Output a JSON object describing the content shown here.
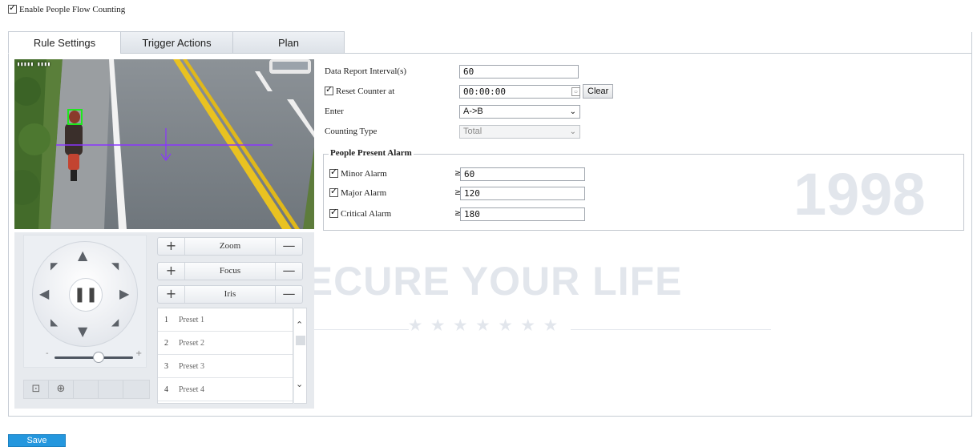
{
  "enable_people_flow": {
    "label": "Enable People Flow Counting",
    "checked": true
  },
  "tabs": [
    {
      "label": "Rule Settings",
      "active": true
    },
    {
      "label": "Trigger Actions",
      "active": false
    },
    {
      "label": "Plan",
      "active": false
    }
  ],
  "video": {
    "icons": {
      "detection_box": "green-detection-box",
      "line": "counting-line",
      "direction": "direction-arrow-down"
    },
    "colors": {
      "line": "#8a35ff",
      "detection_box": "#1ee81e"
    }
  },
  "ptz": {
    "icons": {
      "up": "▲",
      "down": "▼",
      "left": "◀",
      "right": "▶",
      "up_left": "◤",
      "up_right": "◥",
      "down_left": "◣",
      "down_right": "◢",
      "pause": "❚❚"
    },
    "slider_minus": "-",
    "slider_plus": "+",
    "zoom": {
      "label": "Zoom",
      "plus": "+",
      "minus": "—"
    },
    "focus": {
      "label": "Focus",
      "plus": "+",
      "minus": "—"
    },
    "iris": {
      "label": "Iris",
      "plus": "+",
      "minus": "—"
    },
    "presets": [
      {
        "num": "1",
        "name": "Preset 1"
      },
      {
        "num": "2",
        "name": "Preset 2"
      },
      {
        "num": "3",
        "name": "Preset 3"
      },
      {
        "num": "4",
        "name": "Preset 4"
      }
    ]
  },
  "form": {
    "data_report_interval": {
      "label": "Data Report Interval(s)",
      "value": "60"
    },
    "reset_counter": {
      "label": "Reset Counter at",
      "checked": true,
      "value": "00:00:00",
      "clear_label": "Clear"
    },
    "enter": {
      "label": "Enter",
      "value": "A->B"
    },
    "counting_type": {
      "label": "Counting Type",
      "value": "Total"
    },
    "alarm_section": {
      "legend": "People Present Alarm"
    },
    "minor_alarm": {
      "label": "Minor Alarm",
      "checked": true,
      "op": "≥",
      "value": "60"
    },
    "major_alarm": {
      "label": "Major Alarm",
      "checked": true,
      "op": "≥",
      "value": "120"
    },
    "critical_alarm": {
      "label": "Critical Alarm",
      "checked": true,
      "op": "≥",
      "value": "180"
    }
  },
  "save_label": "Save",
  "accent_color": "#2497de"
}
